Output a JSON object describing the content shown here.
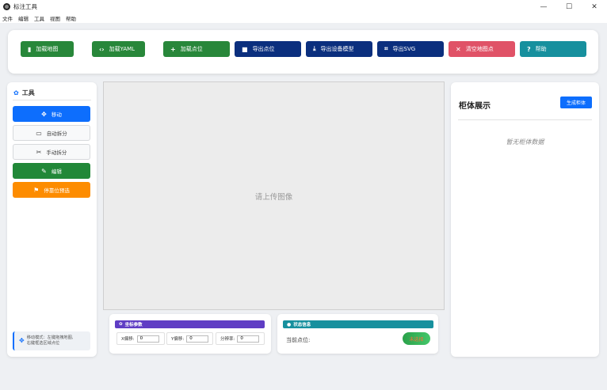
{
  "window": {
    "title": "标注工具",
    "controls": {
      "minimize": "—",
      "maximize": "☐",
      "close": "✕"
    }
  },
  "menu": [
    "文件",
    "编辑",
    "工具",
    "视图",
    "帮助"
  ],
  "toolbar": {
    "buttons": [
      {
        "label": "加载地图",
        "icon": "map-icon",
        "glyph": "▮",
        "color": "#28873a"
      },
      {
        "label": "加载YAML",
        "icon": "code-icon",
        "glyph": "‹›",
        "color": "#28873a"
      },
      {
        "label": "加载点位",
        "icon": "plus-icon",
        "glyph": "+",
        "color": "#28873a"
      },
      {
        "label": "导出点位",
        "icon": "save-icon",
        "glyph": "■",
        "color": "#0b2f7e"
      },
      {
        "label": "导出设备模型",
        "icon": "download-icon",
        "glyph": "⤓",
        "color": "#0b2f7e"
      },
      {
        "label": "导出SVG",
        "icon": "crop-icon",
        "glyph": "⌗",
        "color": "#0b2f7e"
      },
      {
        "label": "清空地图点",
        "icon": "x-icon",
        "glyph": "✕",
        "color": "#e05267"
      },
      {
        "label": "帮助",
        "icon": "help-icon",
        "glyph": "?",
        "color": "#17909e"
      }
    ]
  },
  "tools": {
    "title": "工具",
    "title_icon": "gear-icon",
    "buttons": [
      {
        "label": "移动",
        "icon": "move-icon",
        "glyph": "✥",
        "style": "primary"
      },
      {
        "label": "自动拆分",
        "icon": "ruler-icon",
        "glyph": "▭",
        "style": "outline"
      },
      {
        "label": "手动拆分",
        "icon": "scissors-icon",
        "glyph": "✂",
        "style": "outline"
      },
      {
        "label": "编辑",
        "icon": "pencil-icon",
        "glyph": "✎",
        "style": "green"
      },
      {
        "label": "停靠位预选",
        "icon": "dock-icon",
        "glyph": "⚑",
        "style": "orange"
      }
    ],
    "hint_line1": "移动模式：左键拖拽地图,",
    "hint_line2": "右键框选区域点位"
  },
  "canvas": {
    "placeholder": "请上传图像"
  },
  "coord_params": {
    "title": "坐标参数",
    "x_offset_label": "X偏移:",
    "x_offset_value": "0",
    "y_offset_label": "Y偏移:",
    "y_offset_value": "0",
    "resolution_label": "分辨率:",
    "resolution_value": "0"
  },
  "status_info": {
    "title": "状态信息",
    "current_point_label": "当前点位:",
    "status_value": "未选择"
  },
  "cabinet": {
    "title": "柜体展示",
    "generate_button": "生成柜体",
    "empty_text": "暂无柜体数据"
  }
}
